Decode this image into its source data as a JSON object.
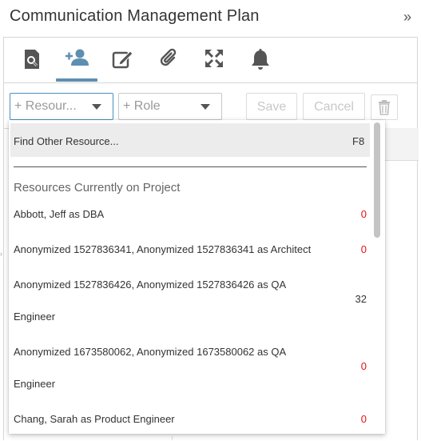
{
  "title": "Communication Management Plan",
  "collapse_glyph": "»",
  "tabs": [
    {
      "name": "search-doc-icon"
    },
    {
      "name": "add-person-icon",
      "active": true
    },
    {
      "name": "edit-icon"
    },
    {
      "name": "paperclip-icon"
    },
    {
      "name": "expand-arrows-icon"
    },
    {
      "name": "bell-icon"
    }
  ],
  "toolbar": {
    "resource_select": "+ Resour...",
    "role_select": "+ Role",
    "save_label": "Save",
    "cancel_label": "Cancel"
  },
  "dropdown": {
    "find_other": "Find Other Resource...",
    "find_shortcut": "F8",
    "section_title": "Resources Currently on Project",
    "items": [
      {
        "line1": "Abbott, Jeff as DBA",
        "line2": "",
        "count": "0",
        "count_color": "red"
      },
      {
        "line1": "Anonymized 1527836341, Anonymized 1527836341 as Architect",
        "line2": "",
        "count": "0",
        "count_color": "red"
      },
      {
        "line1": "Anonymized 1527836426, Anonymized 1527836426 as QA",
        "line2": "Engineer",
        "count": "32",
        "count_color": "dark"
      },
      {
        "line1": "Anonymized 1673580062, Anonymized 1673580062 as QA",
        "line2": "Engineer",
        "count": "0",
        "count_color": "red"
      },
      {
        "line1": "Chang, Sarah as Product Engineer",
        "line2": "",
        "count": "0",
        "count_color": "red"
      }
    ]
  },
  "colors": {
    "accent": "#5f8fb0",
    "count_zero": "#e01010",
    "icon": "#555555"
  }
}
